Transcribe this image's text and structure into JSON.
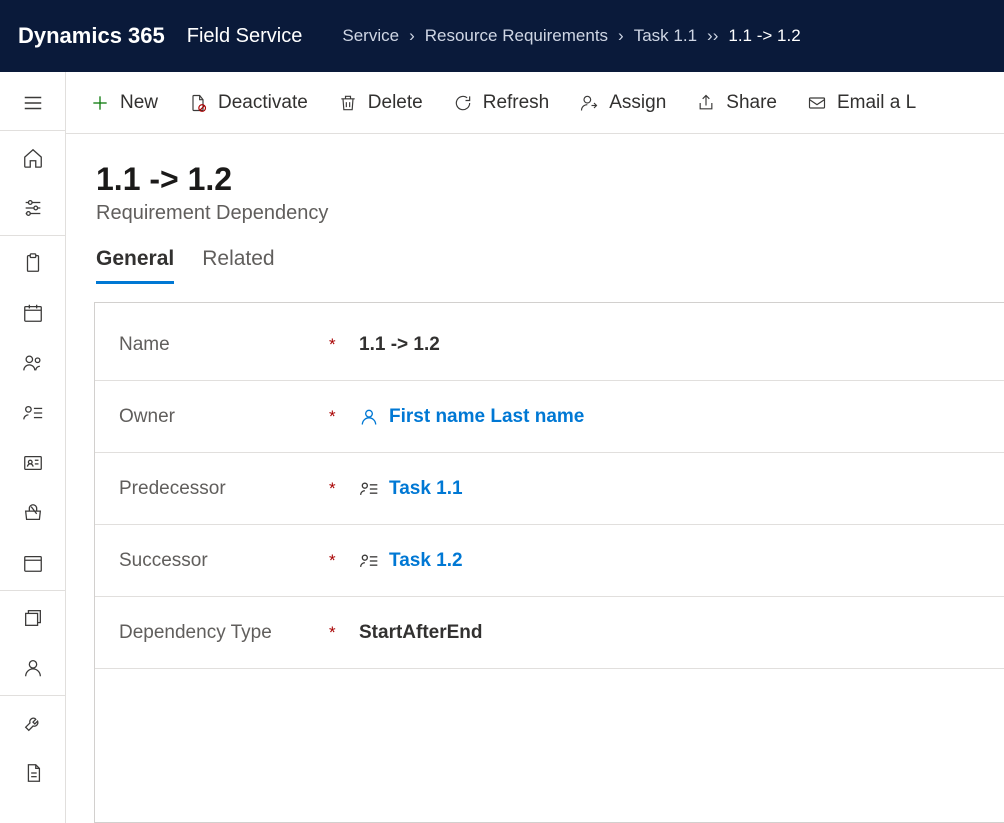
{
  "header": {
    "brand": "Dynamics 365",
    "app": "Field Service",
    "breadcrumbs": [
      "Service",
      "Resource Requirements",
      "Task 1.1",
      "1.1 -> 1.2"
    ]
  },
  "commands": {
    "new": "New",
    "deactivate": "Deactivate",
    "delete": "Delete",
    "refresh": "Refresh",
    "assign": "Assign",
    "share": "Share",
    "email": "Email a L"
  },
  "page": {
    "title": "1.1 -> 1.2",
    "subtitle": "Requirement Dependency"
  },
  "tabs": {
    "general": "General",
    "related": "Related"
  },
  "form": {
    "name_label": "Name",
    "name_value": "1.1 -> 1.2",
    "owner_label": "Owner",
    "owner_value": "First name Last name",
    "predecessor_label": "Predecessor",
    "predecessor_value": "Task 1.1",
    "successor_label": "Successor",
    "successor_value": "Task 1.2",
    "deptype_label": "Dependency Type",
    "deptype_value": "StartAfterEnd",
    "required_mark": "*"
  }
}
